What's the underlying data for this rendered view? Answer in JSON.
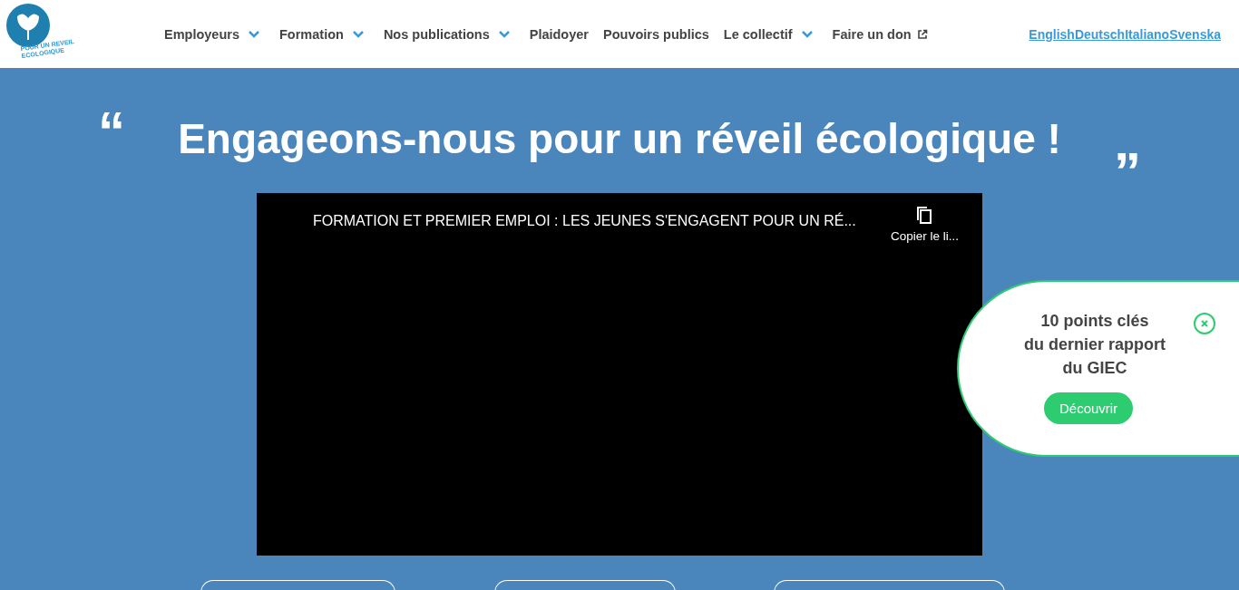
{
  "logo": {
    "lines": [
      "POUR UN REVEIL",
      "ECOLOGIQUE"
    ]
  },
  "nav": [
    {
      "label": "Employeurs",
      "kind": "dropdown"
    },
    {
      "label": "Formation",
      "kind": "dropdown"
    },
    {
      "label": "Nos publications",
      "kind": "dropdown"
    },
    {
      "label": "Plaidoyer",
      "kind": "link"
    },
    {
      "label": "Pouvoirs publics",
      "kind": "link"
    },
    {
      "label": "Le collectif",
      "kind": "dropdown"
    },
    {
      "label": "Faire un don",
      "kind": "external"
    }
  ],
  "languages": [
    "English",
    "Deutsch",
    "Italiano",
    "Svenska"
  ],
  "hero": {
    "open_quote": "“",
    "title": "Engageons-nous pour un réveil écologique !",
    "close_quote": "”"
  },
  "video": {
    "title": "FORMATION ET PREMIER EMPLOI : LES JEUNES S'ENGAGENT POUR UN RÉ...",
    "copy_label": "Copier le li..."
  },
  "popup": {
    "title_lines": [
      "10 points clés",
      "du dernier rapport",
      "du GIEC"
    ],
    "button": "Découvrir"
  },
  "bottom_buttons": [
    {
      "kind": "outline"
    },
    {
      "kind": "outline"
    },
    {
      "kind": "outline"
    }
  ]
}
